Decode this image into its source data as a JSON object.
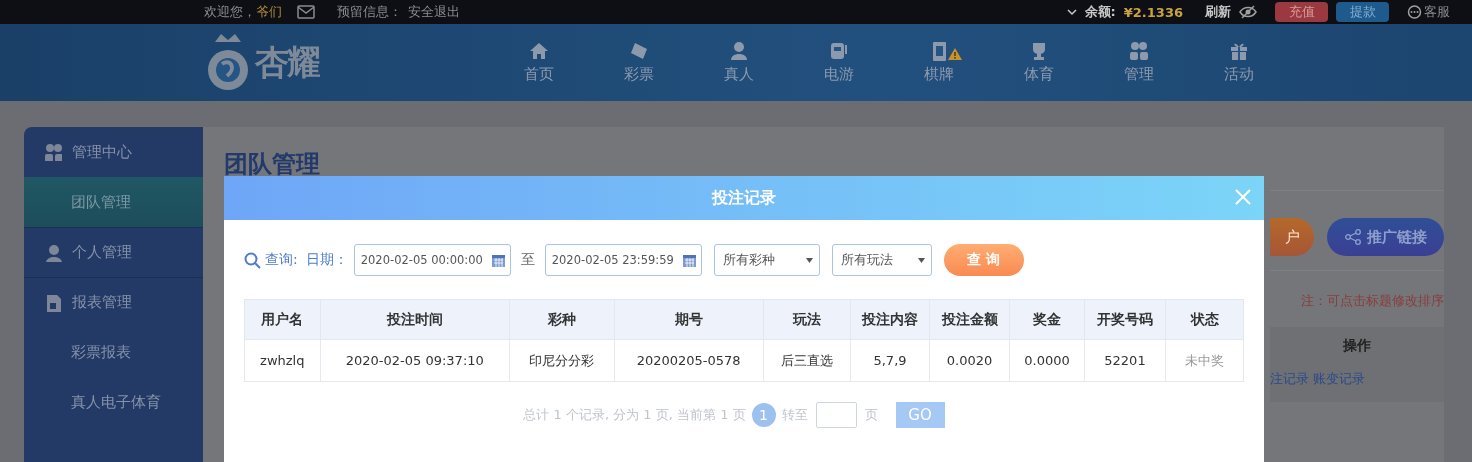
{
  "top_bar": {
    "welcome": "欢迎您，",
    "username": "爷们",
    "reserved_label": "预留信息：",
    "logout": "安全退出",
    "balance_label": "余额:",
    "balance": "¥2.1336",
    "refresh": "刷新",
    "deposit": "充值",
    "withdraw": "提款",
    "service": "客服"
  },
  "nav": {
    "logo": "杏耀",
    "items": [
      {
        "label": "首页",
        "kind": "home",
        "alert": false
      },
      {
        "label": "彩票",
        "kind": "ticket",
        "alert": false
      },
      {
        "label": "真人",
        "kind": "person",
        "alert": false
      },
      {
        "label": "电游",
        "kind": "slot",
        "alert": false
      },
      {
        "label": "棋牌",
        "kind": "cards",
        "alert": true
      },
      {
        "label": "体育",
        "kind": "trophy",
        "alert": false
      },
      {
        "label": "管理",
        "kind": "group",
        "alert": false
      },
      {
        "label": "活动",
        "kind": "gift",
        "alert": false
      }
    ]
  },
  "sidebar": {
    "groups": [
      {
        "label": "管理中心",
        "kind": "group",
        "selected": false,
        "children": [
          {
            "label": "团队管理",
            "selected": true
          }
        ]
      },
      {
        "label": "个人管理",
        "kind": "person",
        "selected": false
      },
      {
        "label": "报表管理",
        "kind": "report",
        "selected": false,
        "children": [
          {
            "label": "彩票报表",
            "selected": false
          },
          {
            "label": "真人电子体育",
            "selected": false
          }
        ]
      }
    ]
  },
  "main": {
    "title": "团队管理",
    "buttons": [
      {
        "label": "户",
        "kind": "open"
      },
      {
        "label": "推广链接",
        "kind": "share"
      }
    ],
    "note": "注：可点击标题修改排序",
    "table_header": "操作",
    "links": [
      "注记录",
      "账变记录"
    ]
  },
  "modal": {
    "title": "投注记录",
    "query": {
      "label": "查询:",
      "date_label": "日期：",
      "start": "2020-02-05 00:00:00",
      "to": "至",
      "end": "2020-02-05 23:59:59",
      "lottery": "所有彩种",
      "play": "所有玩法",
      "button": "查 询"
    },
    "columns": [
      "用户名",
      "投注时间",
      "彩种",
      "期号",
      "玩法",
      "投注内容",
      "投注金额",
      "奖金",
      "开奖号码",
      "状态"
    ],
    "rows": [
      [
        "zwhzlq",
        "2020-02-05 09:37:10",
        "印尼分分彩",
        "20200205-0578",
        "后三直选",
        "5,7,9",
        "0.0020",
        "0.0000",
        "52201",
        "未中奖"
      ]
    ],
    "pagination": {
      "summary": "总计 1 个记录, 分为 1 页, 当前第 1 页",
      "current": "1",
      "goto": "转至",
      "unit": "页",
      "go": "GO"
    }
  }
}
